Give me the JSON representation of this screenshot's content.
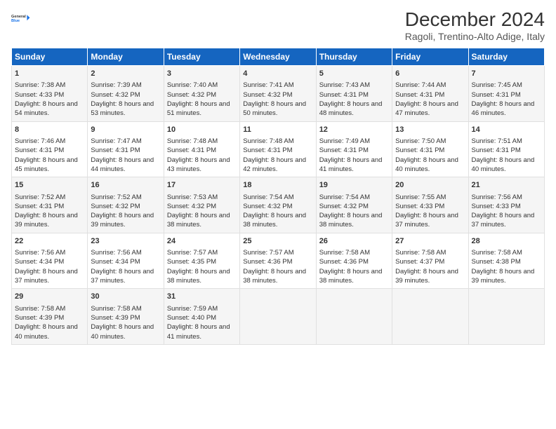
{
  "logo": {
    "line1": "General",
    "line2": "Blue"
  },
  "title": "December 2024",
  "subtitle": "Ragoli, Trentino-Alto Adige, Italy",
  "days_of_week": [
    "Sunday",
    "Monday",
    "Tuesday",
    "Wednesday",
    "Thursday",
    "Friday",
    "Saturday"
  ],
  "weeks": [
    [
      {
        "day": "1",
        "sunrise": "7:38 AM",
        "sunset": "4:33 PM",
        "daylight": "8 hours and 54 minutes."
      },
      {
        "day": "2",
        "sunrise": "7:39 AM",
        "sunset": "4:32 PM",
        "daylight": "8 hours and 53 minutes."
      },
      {
        "day": "3",
        "sunrise": "7:40 AM",
        "sunset": "4:32 PM",
        "daylight": "8 hours and 51 minutes."
      },
      {
        "day": "4",
        "sunrise": "7:41 AM",
        "sunset": "4:32 PM",
        "daylight": "8 hours and 50 minutes."
      },
      {
        "day": "5",
        "sunrise": "7:43 AM",
        "sunset": "4:31 PM",
        "daylight": "8 hours and 48 minutes."
      },
      {
        "day": "6",
        "sunrise": "7:44 AM",
        "sunset": "4:31 PM",
        "daylight": "8 hours and 47 minutes."
      },
      {
        "day": "7",
        "sunrise": "7:45 AM",
        "sunset": "4:31 PM",
        "daylight": "8 hours and 46 minutes."
      }
    ],
    [
      {
        "day": "8",
        "sunrise": "7:46 AM",
        "sunset": "4:31 PM",
        "daylight": "8 hours and 45 minutes."
      },
      {
        "day": "9",
        "sunrise": "7:47 AM",
        "sunset": "4:31 PM",
        "daylight": "8 hours and 44 minutes."
      },
      {
        "day": "10",
        "sunrise": "7:48 AM",
        "sunset": "4:31 PM",
        "daylight": "8 hours and 43 minutes."
      },
      {
        "day": "11",
        "sunrise": "7:48 AM",
        "sunset": "4:31 PM",
        "daylight": "8 hours and 42 minutes."
      },
      {
        "day": "12",
        "sunrise": "7:49 AM",
        "sunset": "4:31 PM",
        "daylight": "8 hours and 41 minutes."
      },
      {
        "day": "13",
        "sunrise": "7:50 AM",
        "sunset": "4:31 PM",
        "daylight": "8 hours and 40 minutes."
      },
      {
        "day": "14",
        "sunrise": "7:51 AM",
        "sunset": "4:31 PM",
        "daylight": "8 hours and 40 minutes."
      }
    ],
    [
      {
        "day": "15",
        "sunrise": "7:52 AM",
        "sunset": "4:31 PM",
        "daylight": "8 hours and 39 minutes."
      },
      {
        "day": "16",
        "sunrise": "7:52 AM",
        "sunset": "4:32 PM",
        "daylight": "8 hours and 39 minutes."
      },
      {
        "day": "17",
        "sunrise": "7:53 AM",
        "sunset": "4:32 PM",
        "daylight": "8 hours and 38 minutes."
      },
      {
        "day": "18",
        "sunrise": "7:54 AM",
        "sunset": "4:32 PM",
        "daylight": "8 hours and 38 minutes."
      },
      {
        "day": "19",
        "sunrise": "7:54 AM",
        "sunset": "4:32 PM",
        "daylight": "8 hours and 38 minutes."
      },
      {
        "day": "20",
        "sunrise": "7:55 AM",
        "sunset": "4:33 PM",
        "daylight": "8 hours and 37 minutes."
      },
      {
        "day": "21",
        "sunrise": "7:56 AM",
        "sunset": "4:33 PM",
        "daylight": "8 hours and 37 minutes."
      }
    ],
    [
      {
        "day": "22",
        "sunrise": "7:56 AM",
        "sunset": "4:34 PM",
        "daylight": "8 hours and 37 minutes."
      },
      {
        "day": "23",
        "sunrise": "7:56 AM",
        "sunset": "4:34 PM",
        "daylight": "8 hours and 37 minutes."
      },
      {
        "day": "24",
        "sunrise": "7:57 AM",
        "sunset": "4:35 PM",
        "daylight": "8 hours and 38 minutes."
      },
      {
        "day": "25",
        "sunrise": "7:57 AM",
        "sunset": "4:36 PM",
        "daylight": "8 hours and 38 minutes."
      },
      {
        "day": "26",
        "sunrise": "7:58 AM",
        "sunset": "4:36 PM",
        "daylight": "8 hours and 38 minutes."
      },
      {
        "day": "27",
        "sunrise": "7:58 AM",
        "sunset": "4:37 PM",
        "daylight": "8 hours and 39 minutes."
      },
      {
        "day": "28",
        "sunrise": "7:58 AM",
        "sunset": "4:38 PM",
        "daylight": "8 hours and 39 minutes."
      }
    ],
    [
      {
        "day": "29",
        "sunrise": "7:58 AM",
        "sunset": "4:39 PM",
        "daylight": "8 hours and 40 minutes."
      },
      {
        "day": "30",
        "sunrise": "7:58 AM",
        "sunset": "4:39 PM",
        "daylight": "8 hours and 40 minutes."
      },
      {
        "day": "31",
        "sunrise": "7:59 AM",
        "sunset": "4:40 PM",
        "daylight": "8 hours and 41 minutes."
      },
      null,
      null,
      null,
      null
    ]
  ],
  "labels": {
    "sunrise": "Sunrise:",
    "sunset": "Sunset:",
    "daylight": "Daylight:"
  }
}
